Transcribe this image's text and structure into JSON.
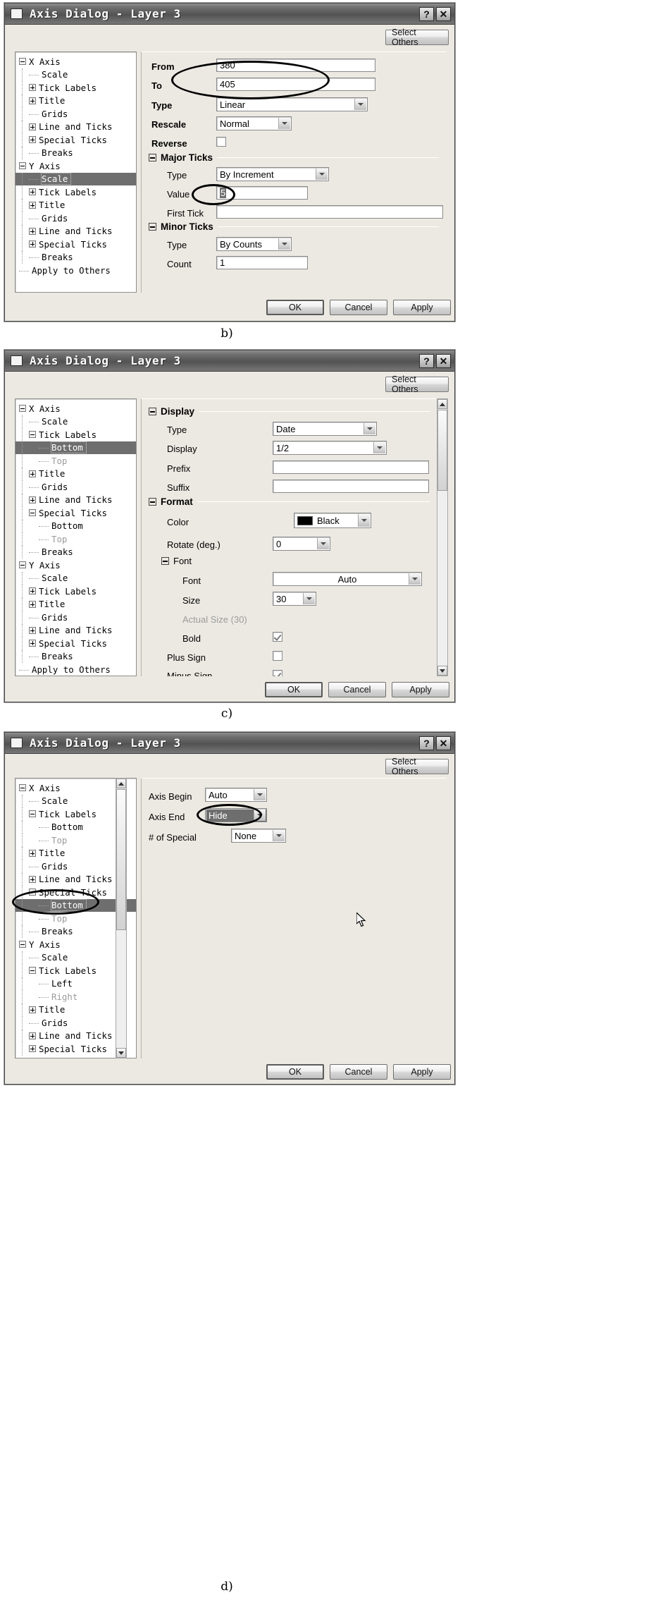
{
  "window_title": "Axis Dialog - Layer 3",
  "titlebar_buttons": {
    "help": "?",
    "close": "✕"
  },
  "common": {
    "select_others": "Select Others",
    "ok": "OK",
    "cancel": "Cancel",
    "apply": "Apply"
  },
  "dialog_b": {
    "caption": "b)",
    "tree": [
      {
        "label": "X Axis",
        "indent": 0,
        "toggle": "minus",
        "selected": false,
        "dim": false
      },
      {
        "label": "Scale",
        "indent": 1,
        "toggle": "none",
        "selected": false,
        "dim": false
      },
      {
        "label": "Tick Labels",
        "indent": 1,
        "toggle": "plus",
        "selected": false,
        "dim": false
      },
      {
        "label": "Title",
        "indent": 1,
        "toggle": "plus",
        "selected": false,
        "dim": false
      },
      {
        "label": "Grids",
        "indent": 1,
        "toggle": "none",
        "selected": false,
        "dim": false
      },
      {
        "label": "Line and Ticks",
        "indent": 1,
        "toggle": "plus",
        "selected": false,
        "dim": false
      },
      {
        "label": "Special Ticks",
        "indent": 1,
        "toggle": "plus",
        "selected": false,
        "dim": false
      },
      {
        "label": "Breaks",
        "indent": 1,
        "toggle": "none",
        "selected": false,
        "dim": false
      },
      {
        "label": "Y Axis",
        "indent": 0,
        "toggle": "minus",
        "selected": false,
        "dim": false
      },
      {
        "label": "Scale",
        "indent": 1,
        "toggle": "none",
        "selected": true,
        "dim": false
      },
      {
        "label": "Tick Labels",
        "indent": 1,
        "toggle": "plus",
        "selected": false,
        "dim": false
      },
      {
        "label": "Title",
        "indent": 1,
        "toggle": "plus",
        "selected": false,
        "dim": false
      },
      {
        "label": "Grids",
        "indent": 1,
        "toggle": "none",
        "selected": false,
        "dim": false
      },
      {
        "label": "Line and Ticks",
        "indent": 1,
        "toggle": "plus",
        "selected": false,
        "dim": false
      },
      {
        "label": "Special Ticks",
        "indent": 1,
        "toggle": "plus",
        "selected": false,
        "dim": false
      },
      {
        "label": "Breaks",
        "indent": 1,
        "toggle": "none",
        "selected": false,
        "dim": false
      },
      {
        "label": "Apply to Others",
        "indent": 0,
        "toggle": "none",
        "selected": false,
        "dim": false
      }
    ],
    "fields": {
      "from_label": "From",
      "from_value": "380",
      "to_label": "To",
      "to_value": "405",
      "type_label": "Type",
      "type_value": "Linear",
      "rescale_label": "Rescale",
      "rescale_value": "Normal",
      "reverse_label": "Reverse",
      "reverse_checked": false,
      "major_ticks_group": "Major Ticks",
      "major_type_label": "Type",
      "major_type_value": "By Increment",
      "major_value_label": "Value",
      "major_value_value": "5",
      "first_tick_label": "First Tick",
      "first_tick_value": "",
      "minor_ticks_group": "Minor Ticks",
      "minor_type_label": "Type",
      "minor_type_value": "By Counts",
      "minor_count_label": "Count",
      "minor_count_value": "1"
    }
  },
  "dialog_c": {
    "caption": "c)",
    "tree": [
      {
        "label": "X Axis",
        "indent": 0,
        "toggle": "minus",
        "selected": false,
        "dim": false
      },
      {
        "label": "Scale",
        "indent": 1,
        "toggle": "none",
        "selected": false,
        "dim": false
      },
      {
        "label": "Tick Labels",
        "indent": 1,
        "toggle": "minus",
        "selected": false,
        "dim": false
      },
      {
        "label": "Bottom",
        "indent": 2,
        "toggle": "none",
        "selected": true,
        "dim": false
      },
      {
        "label": "Top",
        "indent": 2,
        "toggle": "none",
        "selected": false,
        "dim": true
      },
      {
        "label": "Title",
        "indent": 1,
        "toggle": "plus",
        "selected": false,
        "dim": false
      },
      {
        "label": "Grids",
        "indent": 1,
        "toggle": "none",
        "selected": false,
        "dim": false
      },
      {
        "label": "Line and Ticks",
        "indent": 1,
        "toggle": "plus",
        "selected": false,
        "dim": false
      },
      {
        "label": "Special Ticks",
        "indent": 1,
        "toggle": "minus",
        "selected": false,
        "dim": false
      },
      {
        "label": "Bottom",
        "indent": 2,
        "toggle": "none",
        "selected": false,
        "dim": false
      },
      {
        "label": "Top",
        "indent": 2,
        "toggle": "none",
        "selected": false,
        "dim": true
      },
      {
        "label": "Breaks",
        "indent": 1,
        "toggle": "none",
        "selected": false,
        "dim": false
      },
      {
        "label": "Y Axis",
        "indent": 0,
        "toggle": "minus",
        "selected": false,
        "dim": false
      },
      {
        "label": "Scale",
        "indent": 1,
        "toggle": "none",
        "selected": false,
        "dim": false
      },
      {
        "label": "Tick Labels",
        "indent": 1,
        "toggle": "plus",
        "selected": false,
        "dim": false
      },
      {
        "label": "Title",
        "indent": 1,
        "toggle": "plus",
        "selected": false,
        "dim": false
      },
      {
        "label": "Grids",
        "indent": 1,
        "toggle": "none",
        "selected": false,
        "dim": false
      },
      {
        "label": "Line and Ticks",
        "indent": 1,
        "toggle": "plus",
        "selected": false,
        "dim": false
      },
      {
        "label": "Special Ticks",
        "indent": 1,
        "toggle": "plus",
        "selected": false,
        "dim": false
      },
      {
        "label": "Breaks",
        "indent": 1,
        "toggle": "none",
        "selected": false,
        "dim": false
      },
      {
        "label": "Apply to Others",
        "indent": 0,
        "toggle": "none",
        "selected": false,
        "dim": false
      }
    ],
    "fields": {
      "display_group": "Display",
      "type_label": "Type",
      "type_value": "Date",
      "display_label": "Display",
      "display_value": "1/2",
      "prefix_label": "Prefix",
      "prefix_value": "",
      "suffix_label": "Suffix",
      "suffix_value": "",
      "format_group": "Format",
      "color_label": "Color",
      "color_value": "Black",
      "color_hex": "#000000",
      "rotate_label": "Rotate (deg.)",
      "rotate_value": "0",
      "font_group": "Font",
      "font_label": "Font",
      "font_value": "Auto",
      "size_label": "Size",
      "size_value": "30",
      "actual_size_label": "Actual Size (30)",
      "bold_label": "Bold",
      "bold_checked": true,
      "plus_sign_label": "Plus Sign",
      "plus_sign_checked": false,
      "minus_sign_label": "Minus Sign",
      "minus_sign_checked": true
    }
  },
  "dialog_d": {
    "caption": "d)",
    "tree": [
      {
        "label": "X Axis",
        "indent": 0,
        "toggle": "minus",
        "selected": false,
        "dim": false
      },
      {
        "label": "Scale",
        "indent": 1,
        "toggle": "none",
        "selected": false,
        "dim": false
      },
      {
        "label": "Tick Labels",
        "indent": 1,
        "toggle": "minus",
        "selected": false,
        "dim": false
      },
      {
        "label": "Bottom",
        "indent": 2,
        "toggle": "none",
        "selected": false,
        "dim": false
      },
      {
        "label": "Top",
        "indent": 2,
        "toggle": "none",
        "selected": false,
        "dim": true
      },
      {
        "label": "Title",
        "indent": 1,
        "toggle": "plus",
        "selected": false,
        "dim": false
      },
      {
        "label": "Grids",
        "indent": 1,
        "toggle": "none",
        "selected": false,
        "dim": false
      },
      {
        "label": "Line and Ticks",
        "indent": 1,
        "toggle": "plus",
        "selected": false,
        "dim": false
      },
      {
        "label": "Special Ticks",
        "indent": 1,
        "toggle": "minus",
        "selected": false,
        "dim": false
      },
      {
        "label": "Bottom",
        "indent": 2,
        "toggle": "none",
        "selected": true,
        "dim": false
      },
      {
        "label": "Top",
        "indent": 2,
        "toggle": "none",
        "selected": false,
        "dim": true
      },
      {
        "label": "Breaks",
        "indent": 1,
        "toggle": "none",
        "selected": false,
        "dim": false
      },
      {
        "label": "Y Axis",
        "indent": 0,
        "toggle": "minus",
        "selected": false,
        "dim": false
      },
      {
        "label": "Scale",
        "indent": 1,
        "toggle": "none",
        "selected": false,
        "dim": false
      },
      {
        "label": "Tick Labels",
        "indent": 1,
        "toggle": "minus",
        "selected": false,
        "dim": false
      },
      {
        "label": "Left",
        "indent": 2,
        "toggle": "none",
        "selected": false,
        "dim": false
      },
      {
        "label": "Right",
        "indent": 2,
        "toggle": "none",
        "selected": false,
        "dim": true
      },
      {
        "label": "Title",
        "indent": 1,
        "toggle": "plus",
        "selected": false,
        "dim": false
      },
      {
        "label": "Grids",
        "indent": 1,
        "toggle": "none",
        "selected": false,
        "dim": false
      },
      {
        "label": "Line and Ticks",
        "indent": 1,
        "toggle": "plus",
        "selected": false,
        "dim": false
      },
      {
        "label": "Special Ticks",
        "indent": 1,
        "toggle": "plus",
        "selected": false,
        "dim": false
      }
    ],
    "fields": {
      "axis_begin_label": "Axis Begin",
      "axis_begin_value": "Auto",
      "axis_end_label": "Axis End",
      "axis_end_value": "Hide",
      "num_special_label": "# of Special",
      "num_special_value": "None"
    }
  }
}
